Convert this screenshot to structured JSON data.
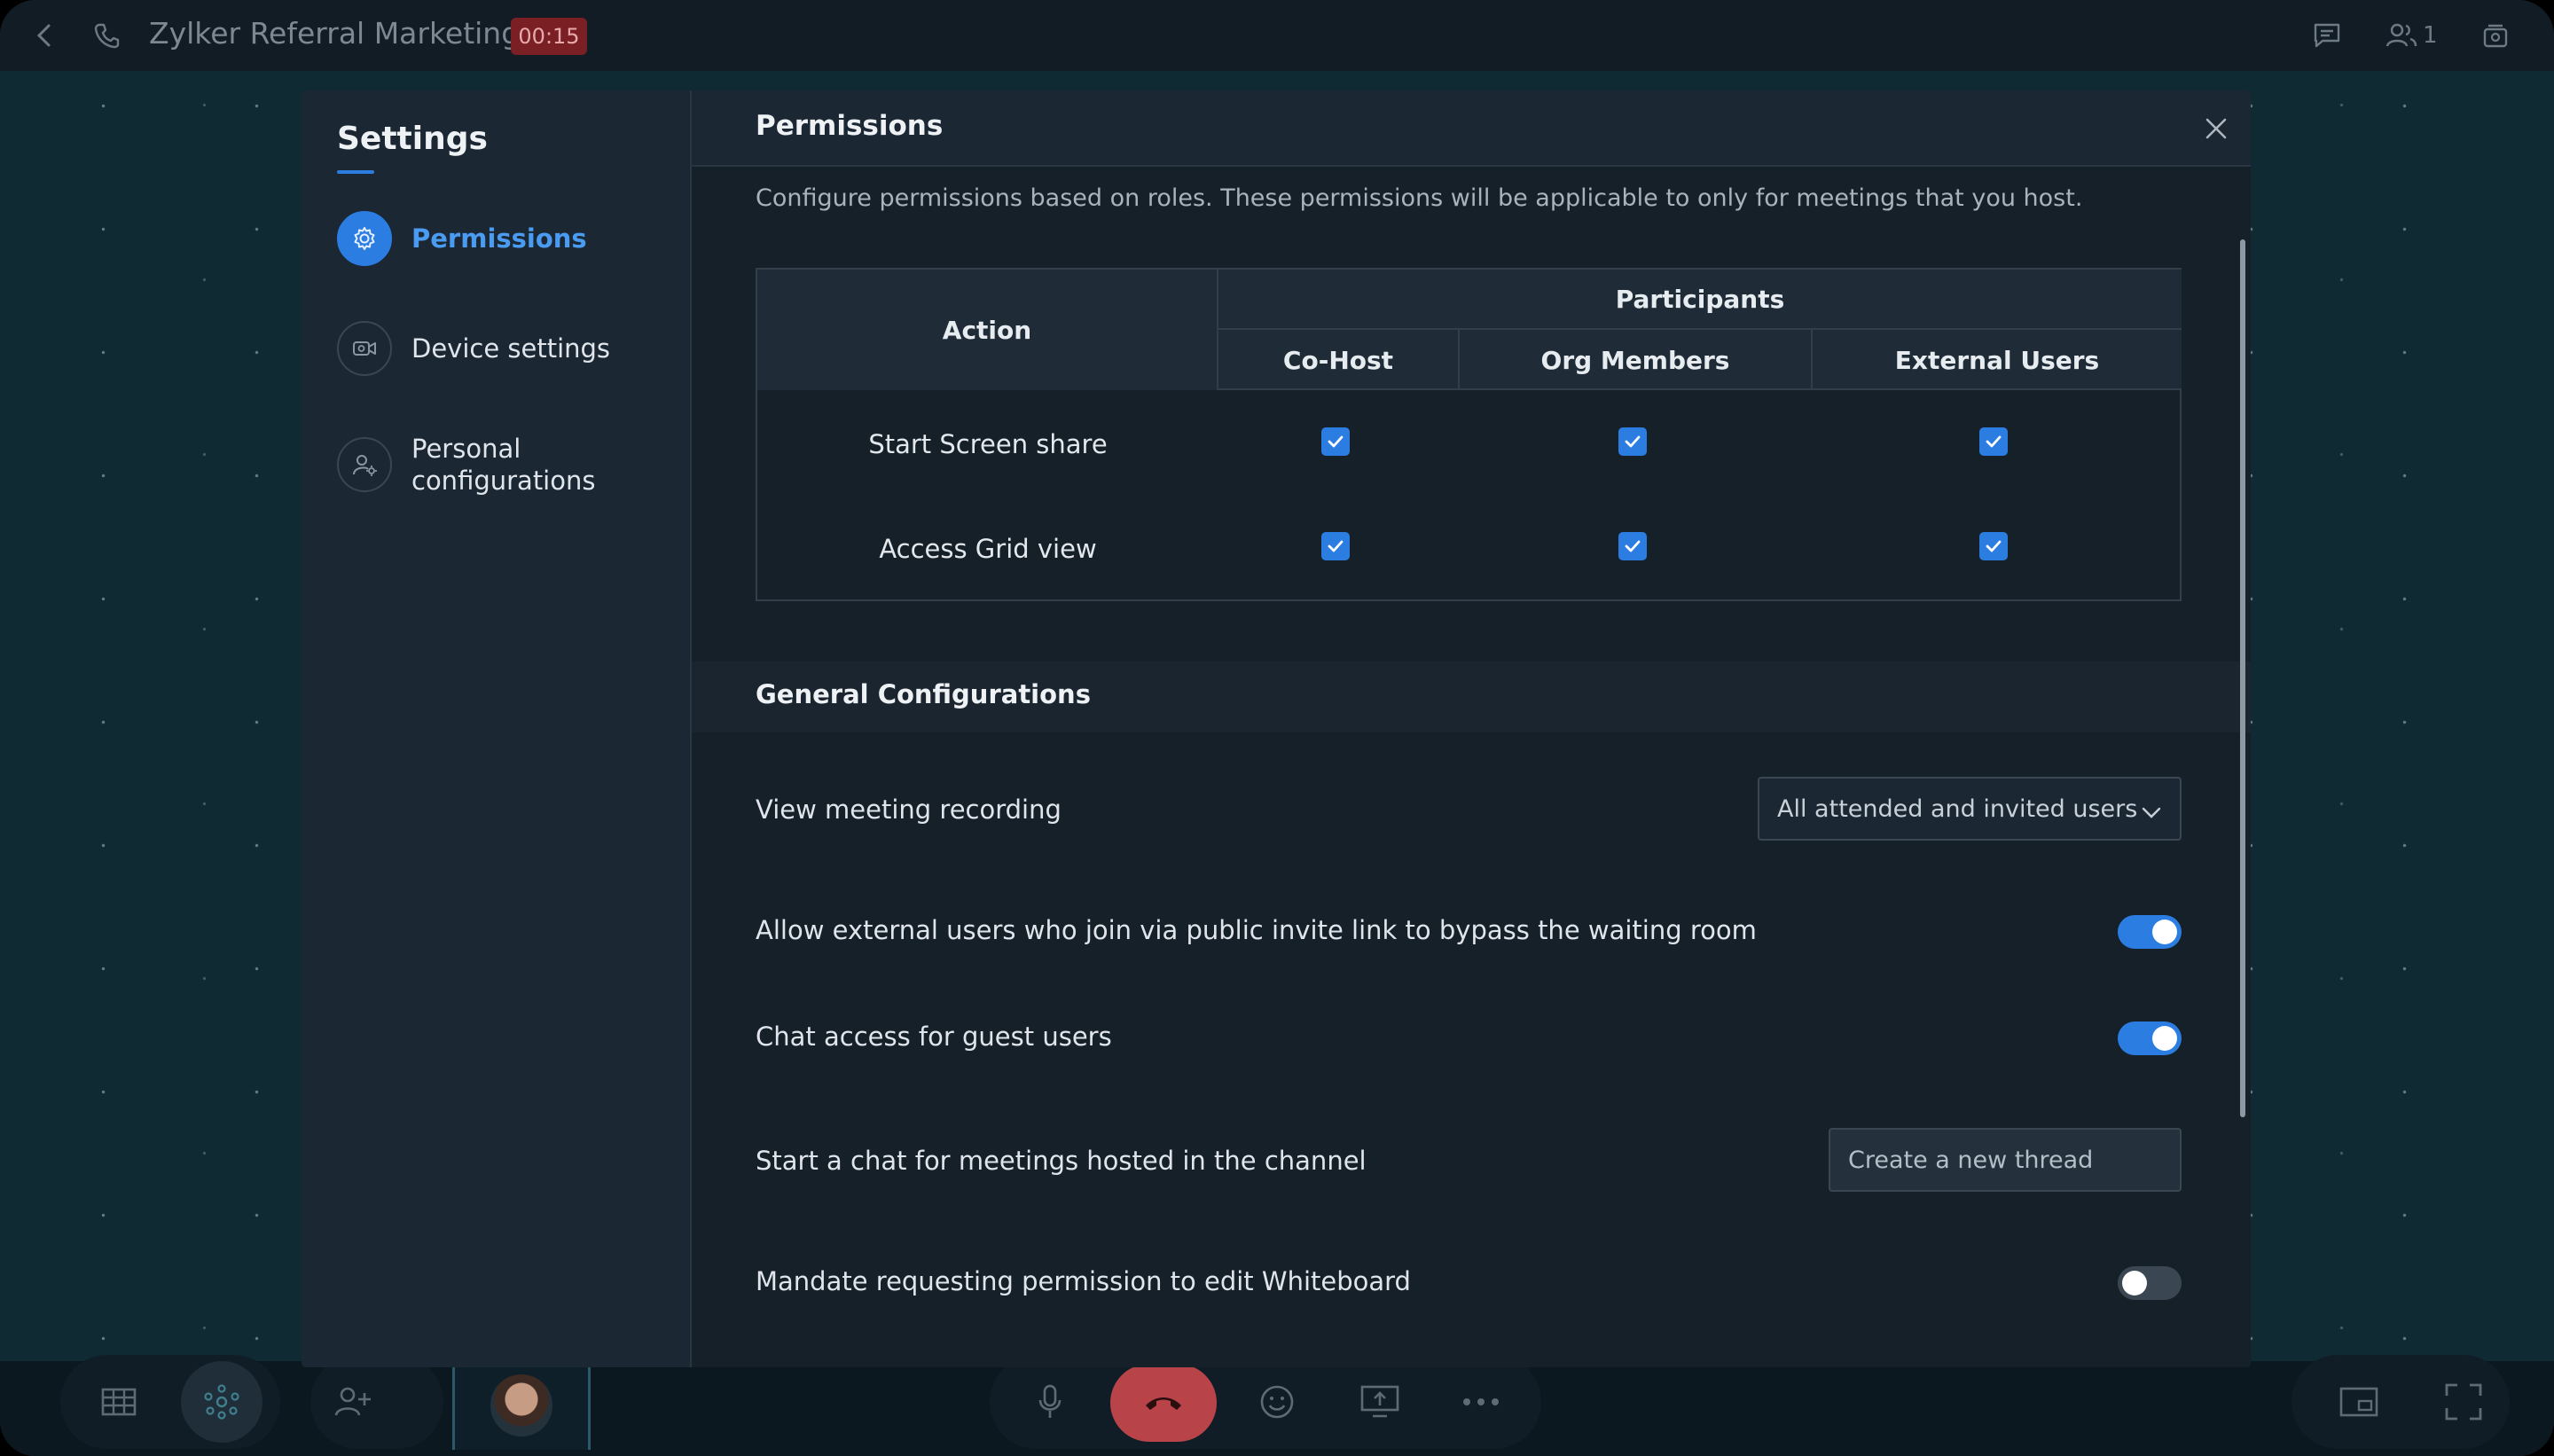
{
  "topbar": {
    "title": "Zylker Referral Marketing",
    "timer": "00:15",
    "participant_count": "1"
  },
  "settings": {
    "title": "Settings",
    "nav": [
      {
        "label": "Permissions",
        "icon": "gear-icon",
        "active": true
      },
      {
        "label": "Device settings",
        "icon": "camera-icon",
        "active": false
      },
      {
        "label": "Personal configurations",
        "icon": "user-gear-icon",
        "active": false
      }
    ]
  },
  "permissions": {
    "title": "Permissions",
    "description": "Configure permissions based on roles. These permissions will be applicable to only for meetings that you host.",
    "table": {
      "action_header": "Action",
      "participants_header": "Participants",
      "columns": [
        "Co-Host",
        "Org Members",
        "External Users"
      ],
      "rows": [
        {
          "action": "Start Screen share",
          "checked": [
            true,
            true,
            true
          ]
        },
        {
          "action": "Access Grid view",
          "checked": [
            true,
            true,
            true
          ]
        }
      ]
    }
  },
  "general": {
    "title": "General Configurations",
    "view_recording": {
      "label": "View meeting recording",
      "value": "All attended and invited users"
    },
    "bypass_waiting_room": {
      "label": "Allow external users who join via public invite link to bypass the waiting room",
      "enabled": true
    },
    "guest_chat": {
      "label": "Chat access for guest users",
      "enabled": true
    },
    "channel_chat": {
      "label": "Start a chat for meetings hosted in the channel",
      "value": "Create a new thread"
    },
    "whiteboard_permission": {
      "label": "Mandate requesting permission to edit Whiteboard",
      "enabled": false
    }
  },
  "colors": {
    "accent": "#2b7de2",
    "timer_bg": "#7a1f24",
    "end_call": "#b8444a",
    "modal_bg": "#1b2733"
  }
}
